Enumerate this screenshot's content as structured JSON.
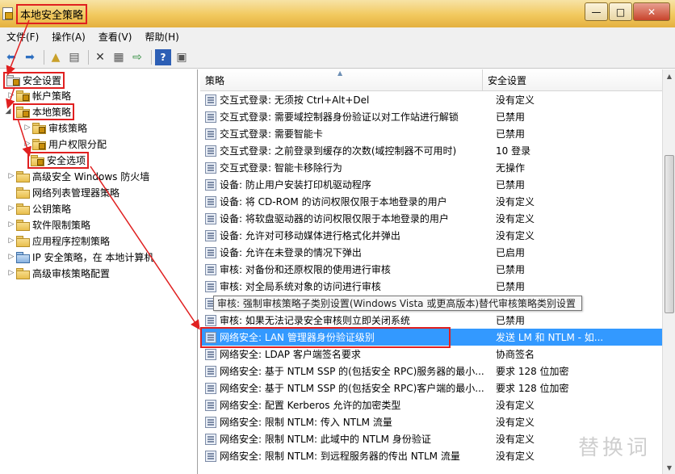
{
  "window": {
    "title": "本地安全策略",
    "controls": [
      "—",
      "□",
      "✕"
    ]
  },
  "menu": [
    "文件(F)",
    "操作(A)",
    "查看(V)",
    "帮助(H)"
  ],
  "toolbar": [
    "back-icon",
    "forward-icon",
    "up-folder-icon",
    "show-tree-icon",
    "delete-icon",
    "properties-icon",
    "export-icon",
    "help-icon",
    "view-icon"
  ],
  "tree": [
    {
      "label": "安全设置",
      "arrow": ""
    },
    {
      "label": "帐户策略",
      "arrow": "▷"
    },
    {
      "label": "本地策略",
      "arrow": "◢"
    },
    {
      "label": "审核策略",
      "arrow": "▷"
    },
    {
      "label": "用户权限分配",
      "arrow": "▷"
    },
    {
      "label": "安全选项",
      "arrow": ""
    },
    {
      "label": "高级安全 Windows 防火墙",
      "arrow": "▷"
    },
    {
      "label": "网络列表管理器策略",
      "arrow": ""
    },
    {
      "label": "公钥策略",
      "arrow": "▷"
    },
    {
      "label": "软件限制策略",
      "arrow": "▷"
    },
    {
      "label": "应用程序控制策略",
      "arrow": "▷"
    },
    {
      "label": "IP 安全策略，在 本地计算机",
      "arrow": "▷"
    },
    {
      "label": "高级审核策略配置",
      "arrow": "▷"
    }
  ],
  "list": {
    "columns": [
      "策略",
      "安全设置"
    ],
    "rows": [
      {
        "policy": "交互式登录: 无须按 Ctrl+Alt+Del",
        "setting": "没有定义"
      },
      {
        "policy": "交互式登录: 需要域控制器身份验证以对工作站进行解锁",
        "setting": "已禁用"
      },
      {
        "policy": "交互式登录: 需要智能卡",
        "setting": "已禁用"
      },
      {
        "policy": "交互式登录: 之前登录到缓存的次数(域控制器不可用时)",
        "setting": "10 登录"
      },
      {
        "policy": "交互式登录: 智能卡移除行为",
        "setting": "无操作"
      },
      {
        "policy": "设备: 防止用户安装打印机驱动程序",
        "setting": "已禁用"
      },
      {
        "policy": "设备: 将 CD-ROM 的访问权限仅限于本地登录的用户",
        "setting": "没有定义"
      },
      {
        "policy": "设备: 将软盘驱动器的访问权限仅限于本地登录的用户",
        "setting": "没有定义"
      },
      {
        "policy": "设备: 允许对可移动媒体进行格式化并弹出",
        "setting": "没有定义"
      },
      {
        "policy": "设备: 允许在未登录的情况下弹出",
        "setting": "已启用"
      },
      {
        "policy": "审核: 对备份和还原权限的使用进行审核",
        "setting": "已禁用"
      },
      {
        "policy": "审核: 对全局系统对象的访问进行审核",
        "setting": "已禁用"
      },
      {
        "policy": "",
        "setting": ""
      },
      {
        "policy": "审核: 如果无法记录安全审核则立即关闭系统",
        "setting": "已禁用"
      },
      {
        "policy": "网络安全: LAN 管理器身份验证级别",
        "setting": "发送 LM 和 NTLM - 如..."
      },
      {
        "policy": "网络安全: LDAP 客户端签名要求",
        "setting": "协商签名"
      },
      {
        "policy": "网络安全: 基于 NTLM SSP 的(包括安全 RPC)服务器的最小...",
        "setting": "要求 128 位加密"
      },
      {
        "policy": "网络安全: 基于 NTLM SSP 的(包括安全 RPC)客户端的最小...",
        "setting": "要求 128 位加密"
      },
      {
        "policy": "网络安全: 配置 Kerberos 允许的加密类型",
        "setting": "没有定义"
      },
      {
        "policy": "网络安全: 限制 NTLM: 传入 NTLM 流量",
        "setting": "没有定义"
      },
      {
        "policy": "网络安全: 限制 NTLM: 此域中的 NTLM 身份验证",
        "setting": "没有定义"
      },
      {
        "policy": "网络安全: 限制 NTLM: 到远程服务器的传出 NTLM 流量",
        "setting": "没有定义"
      }
    ],
    "tooltip": "审核: 强制审核策略子类别设置(Windows Vista 或更高版本)替代审核策略类别设置"
  },
  "watermark": "替换词",
  "colors": {
    "annotation": "#e02020",
    "selection": "#3399ff",
    "title_bar": "#f2c95e"
  }
}
